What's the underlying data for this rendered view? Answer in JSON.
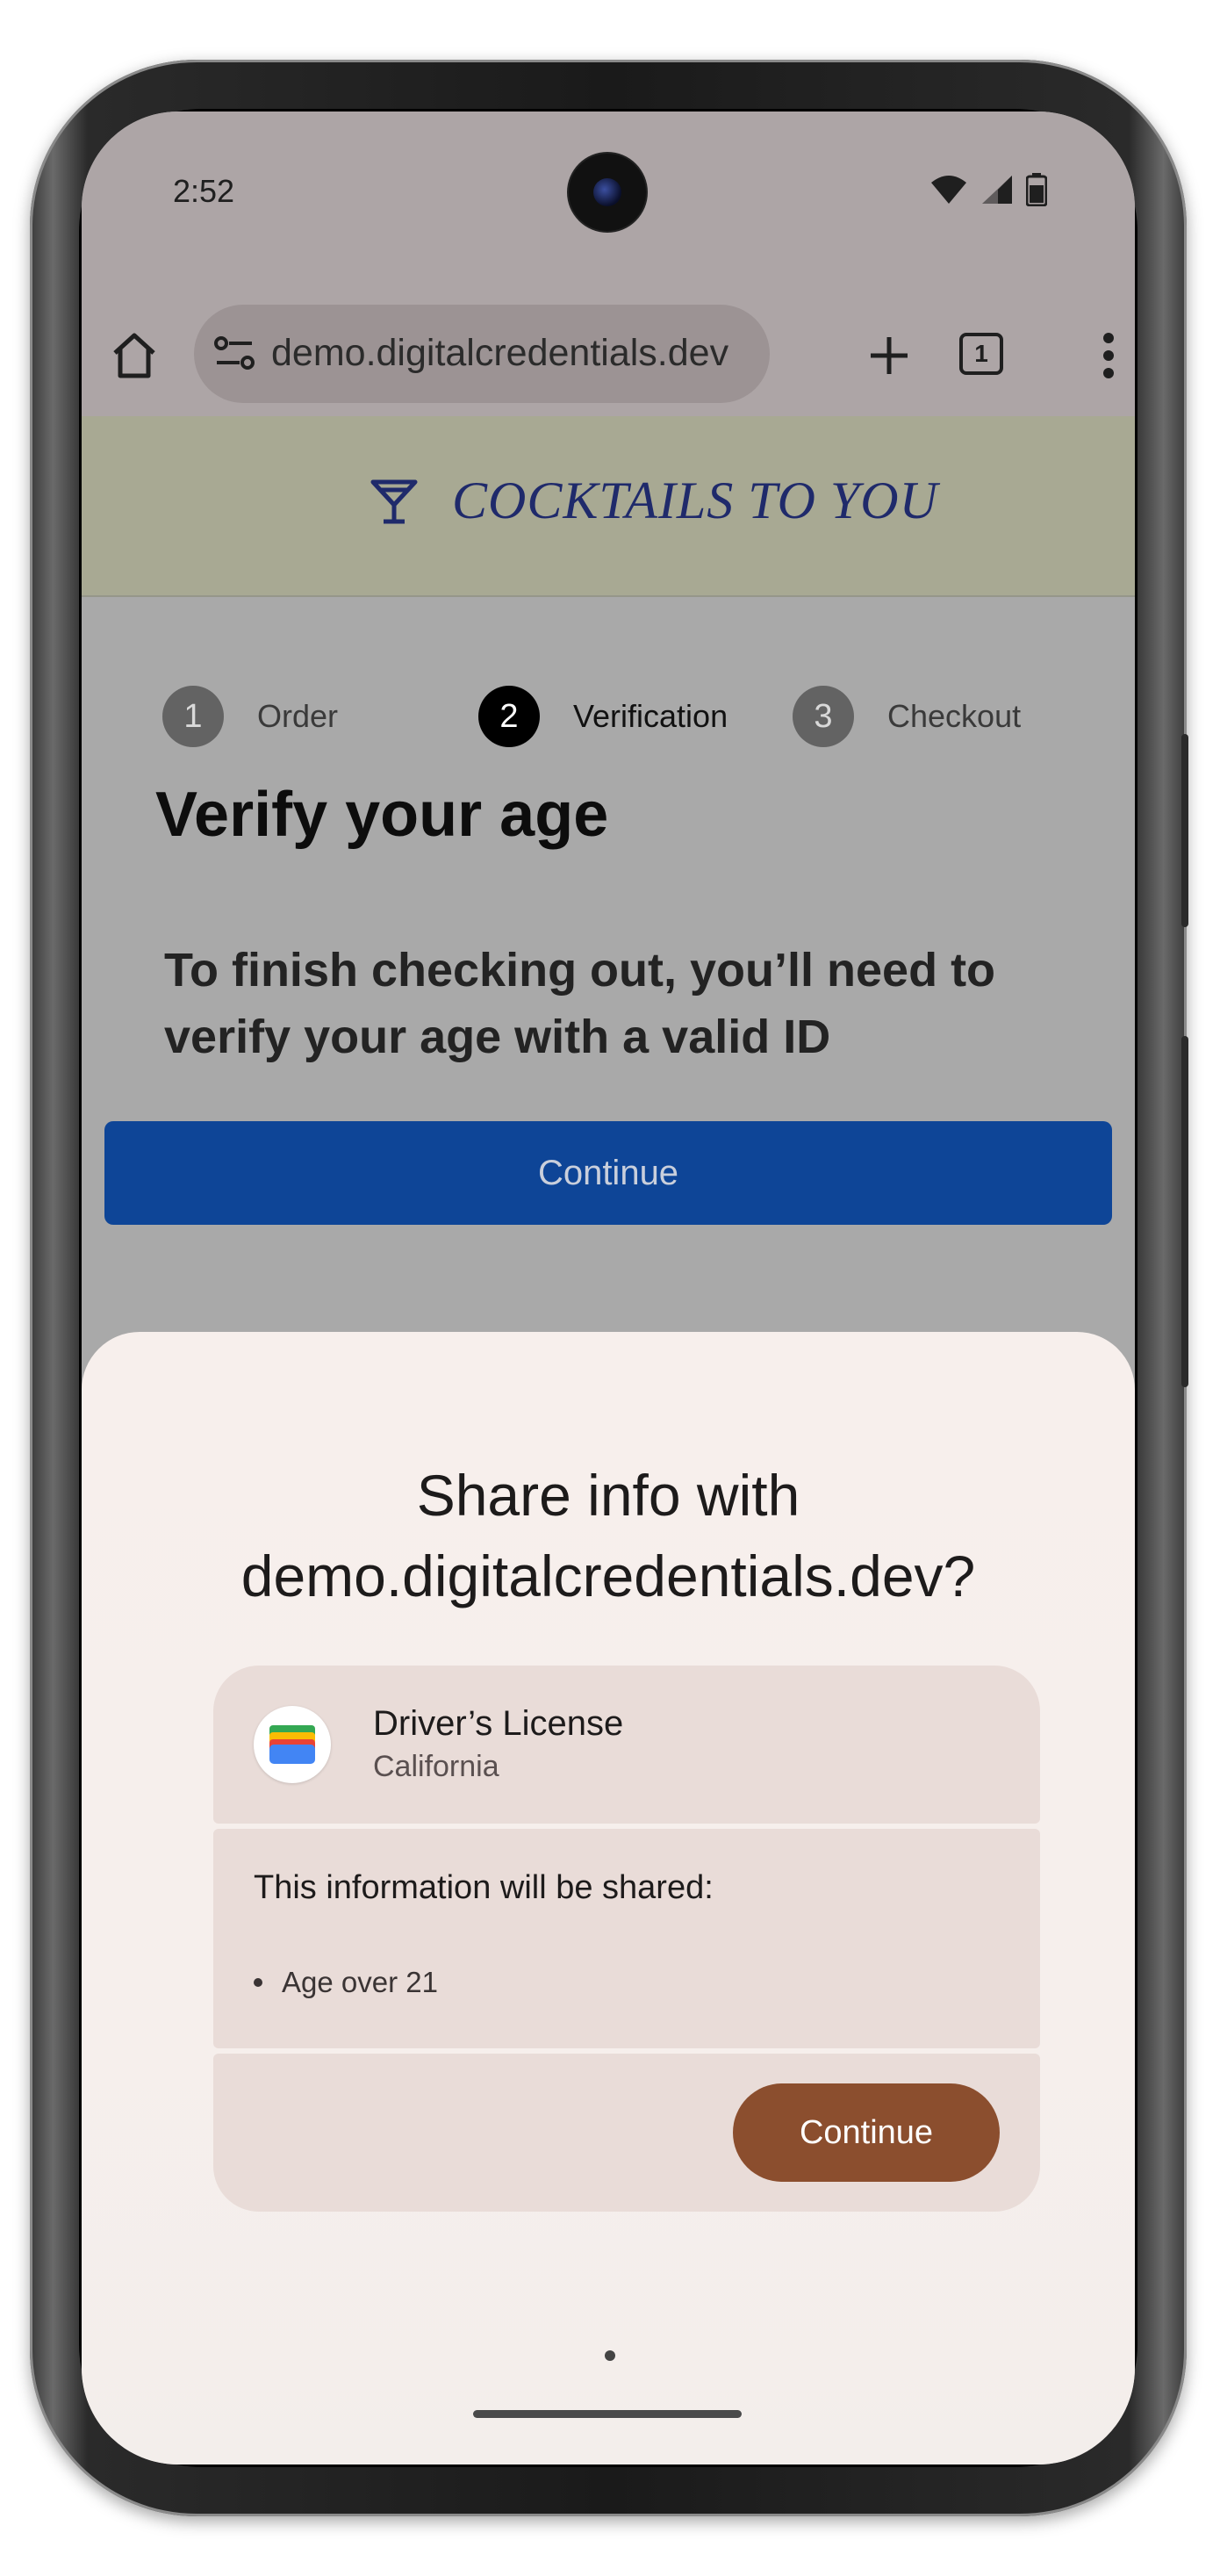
{
  "status_bar": {
    "time": "2:52",
    "icons": [
      "wifi-icon",
      "signal-icon",
      "battery-icon"
    ]
  },
  "browser": {
    "url": "demo.digitalcredentials.dev",
    "tab_count": "1",
    "icons": [
      "home-icon",
      "site-settings-icon",
      "new-tab-icon",
      "tab-switcher-icon",
      "more-menu-icon"
    ]
  },
  "site": {
    "brand": "COCKTAILS TO YOU",
    "brand_icon": "cocktail-glass-icon",
    "brand_color": "#1f2a6b",
    "steps": [
      {
        "num": "1",
        "label": "Order"
      },
      {
        "num": "2",
        "label": "Verification"
      },
      {
        "num": "3",
        "label": "Checkout"
      }
    ],
    "title": "Verify your age",
    "subtitle": "To finish checking out, you’ll need to verify your age with a valid ID",
    "continue_label": "Continue",
    "continue_color": "#0e4597"
  },
  "sheet": {
    "title_line1": "Share info with",
    "title_line2": "demo.digitalcredentials.dev?",
    "credential": {
      "icon": "google-wallet-icon",
      "title": "Driver’s License",
      "subtitle": "California"
    },
    "shared_heading": "This information will be shared:",
    "shared_items": [
      "Age over 21"
    ],
    "continue_label": "Continue",
    "continue_color": "#8b4e2e"
  }
}
